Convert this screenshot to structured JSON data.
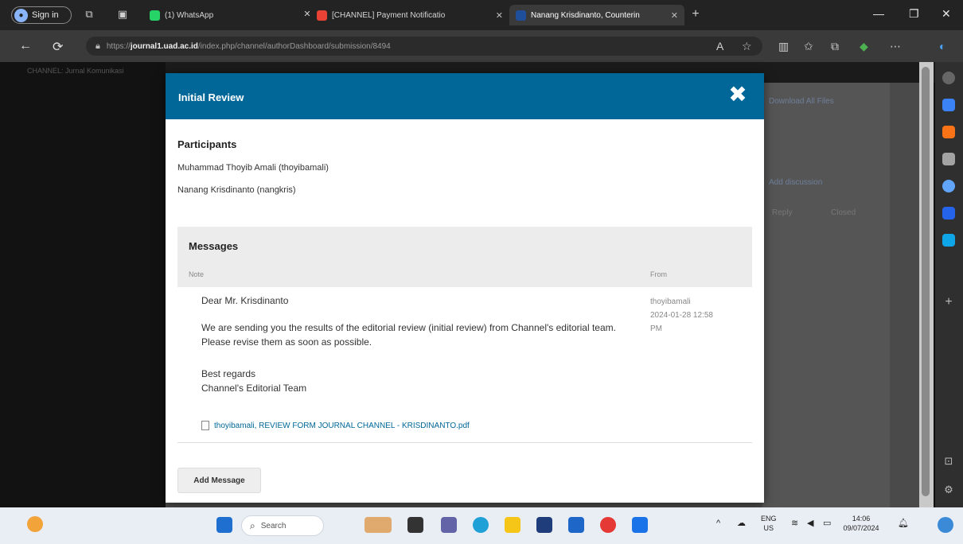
{
  "browser": {
    "signin_label": "Sign in",
    "tabs": [
      {
        "label": "(1) WhatsApp",
        "color": "#25d366"
      },
      {
        "label": "[CHANNEL] Payment Notificatio",
        "color": "#ea4335"
      },
      {
        "label": "Nanang Krisdinanto, Counterin",
        "color": "#1f4e9a"
      }
    ],
    "new_tab_label": "+",
    "url_scheme": "https://",
    "url_host": "journal1.uad.ac.id",
    "url_path": "/index.php/channel/authorDashboard/submission/8494"
  },
  "page": {
    "brand": "CHANNEL: Jurnal Komunikasi",
    "bg_link": "Download All Files",
    "bg_add": "Add discussion",
    "bg_reply": "Reply",
    "bg_closed": "Closed"
  },
  "modal": {
    "title": "Initial Review",
    "close_symbol": "✖",
    "participants_heading": "Participants",
    "participants": [
      "Muhammad Thoyib Amali (thoyibamali)",
      "Nanang Krisdinanto (nangkris)"
    ],
    "messages_heading": "Messages",
    "col_note": "Note",
    "col_from": "From",
    "message": {
      "greeting": "Dear Mr. Krisdinanto",
      "body": "We are sending you the results of the editorial review (initial review) from Channel's editorial team. Please revise them as soon as possible.",
      "closing": "Best regards",
      "signature": "Channel's Editorial Team",
      "attachment": "thoyibamali, REVIEW FORM JOURNAL CHANNEL - KRISDINANTO.pdf",
      "from_user": "thoyibamali",
      "from_date": "2024-01-28 12:58",
      "from_time": "PM"
    },
    "add_message_label": "Add Message"
  },
  "taskbar": {
    "search_placeholder": "Search",
    "lang_line1": "ENG",
    "lang_line2": "US",
    "time": "14:06",
    "date": "09/07/2024"
  },
  "colors": {
    "modal_header": "#006798",
    "link": "#006798"
  }
}
